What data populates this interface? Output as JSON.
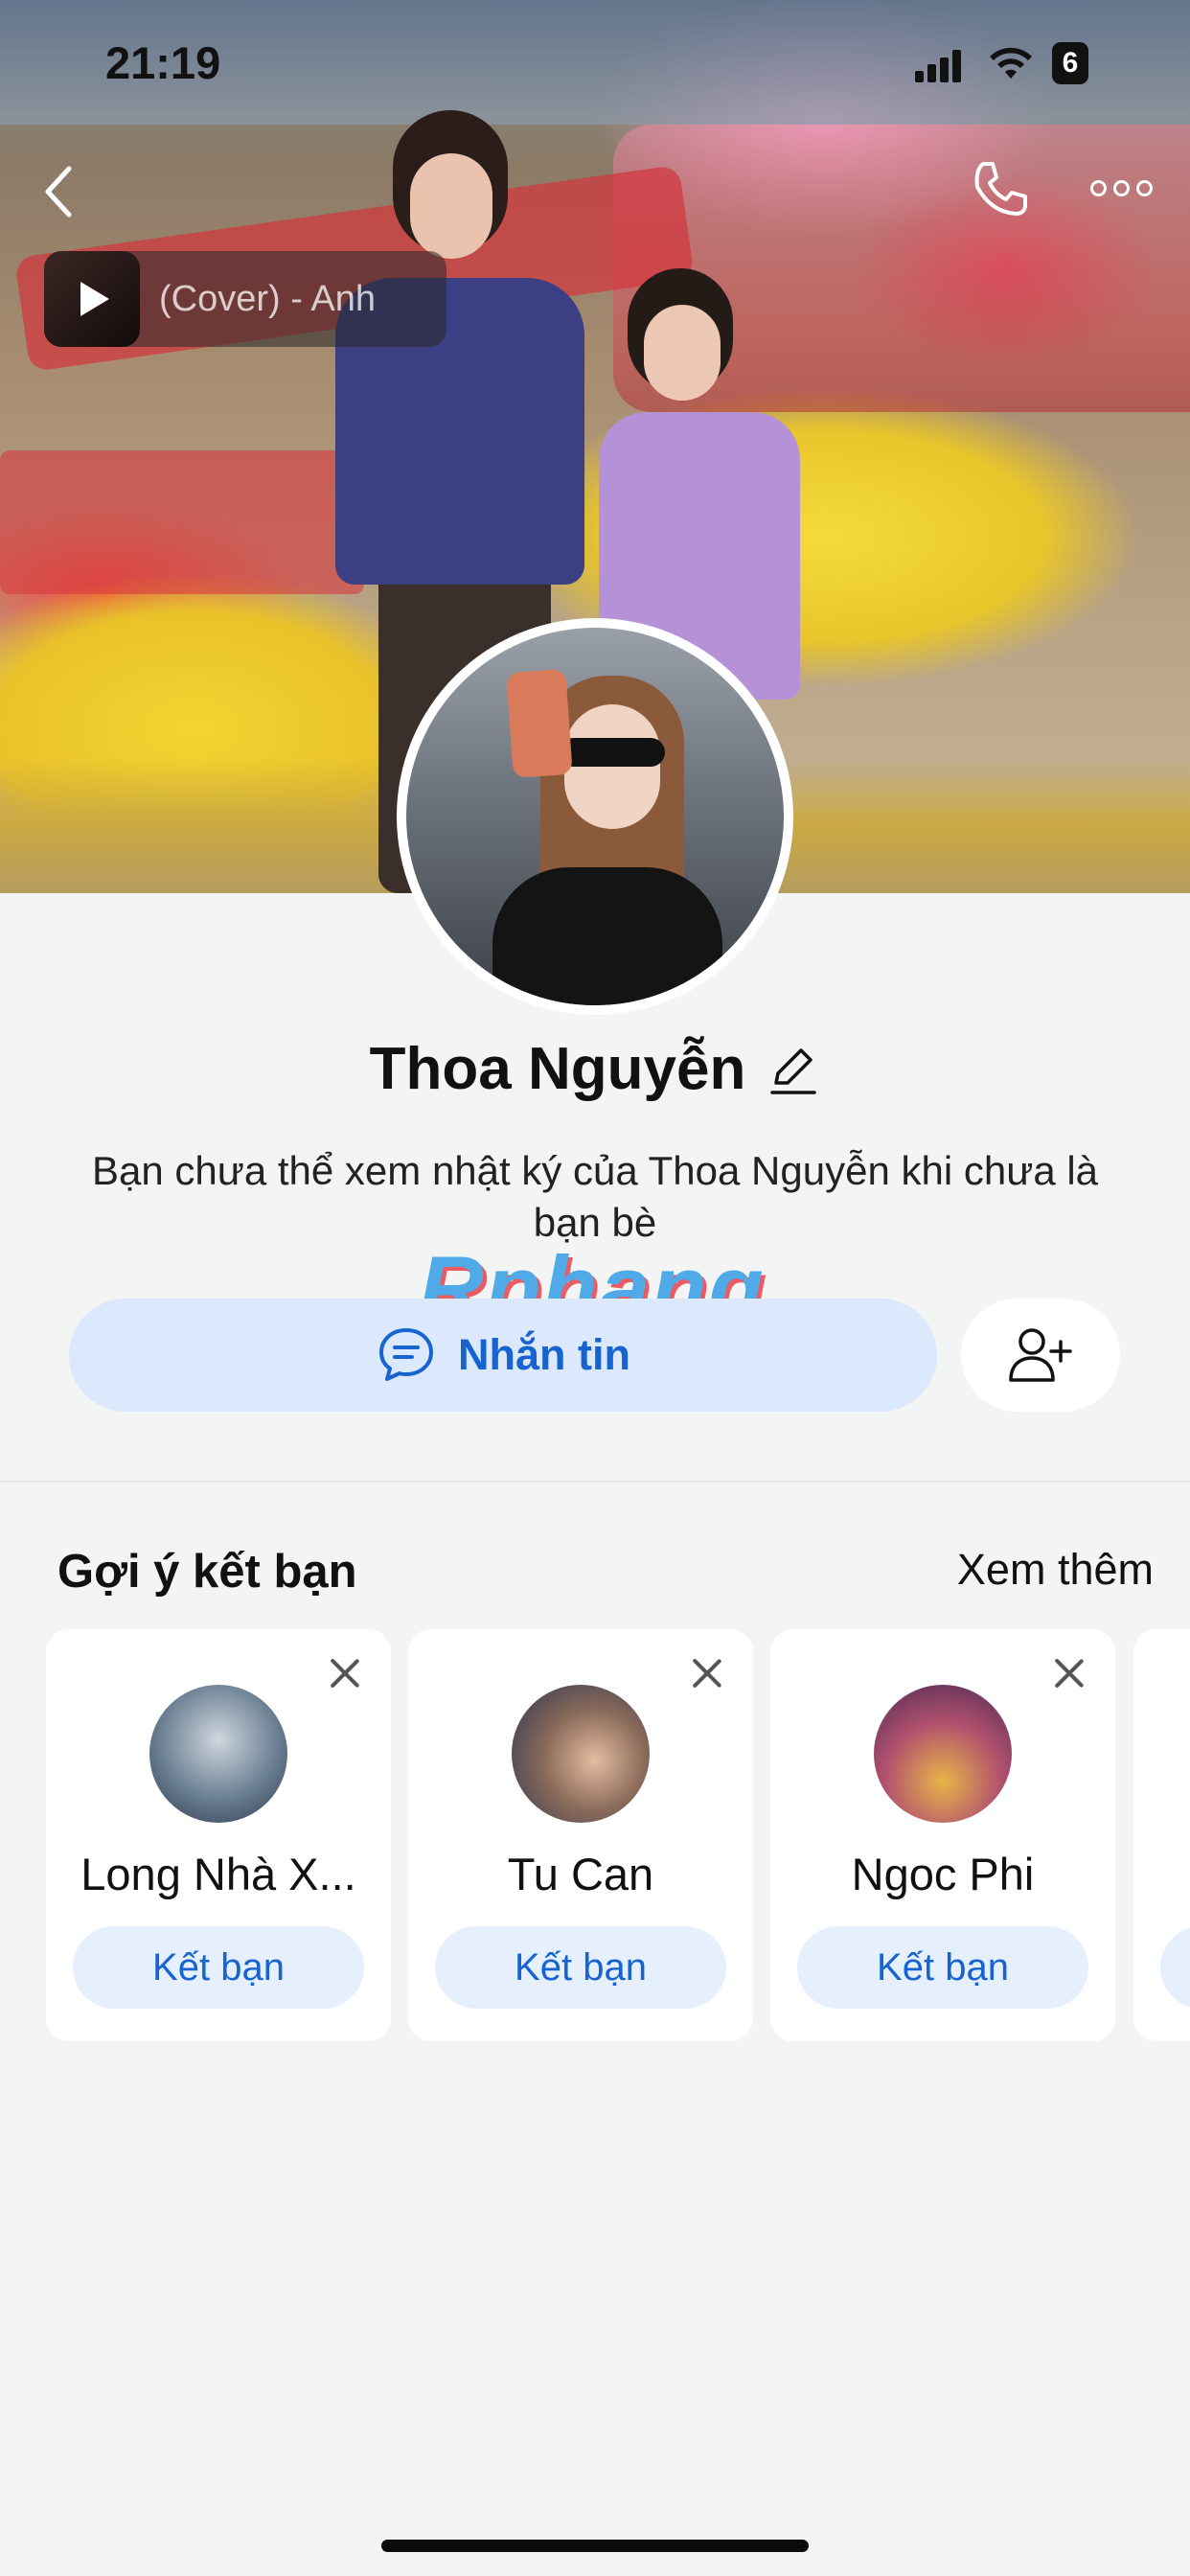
{
  "status_bar": {
    "time": "21:19",
    "battery": "6"
  },
  "header": {
    "back_icon": "chevron-left-icon",
    "call_icon": "phone-icon",
    "more_icon": "more-horizontal-icon"
  },
  "music": {
    "title": "(Cover) - Anh"
  },
  "profile": {
    "name": "Thoa Nguyễn",
    "notice": "Bạn chưa thể xem nhật ký của Thoa Nguyễn khi chưa là bạn bè",
    "message_label": "Nhắn tin"
  },
  "watermark": "Rphang",
  "suggestions": {
    "title": "Gợi ý kết bạn",
    "see_more": "Xem thêm",
    "items": [
      {
        "name": "Long Nhà X...",
        "button": "Kết bạn",
        "avatar_color": "#6a7f92"
      },
      {
        "name": "Tu Can",
        "button": "Kết bạn",
        "avatar_color": "#3b4a6a"
      },
      {
        "name": "Ngoc Phi",
        "button": "Kết bạn",
        "avatar_color": "#8c4a6a"
      }
    ]
  },
  "colors": {
    "accent": "#1764d1",
    "button_bg": "#dce8fb",
    "background": "#f3f4f4"
  }
}
